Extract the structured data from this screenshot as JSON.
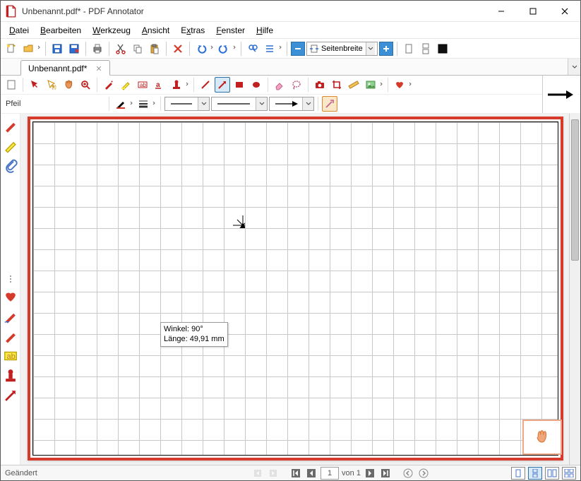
{
  "titlebar": {
    "title": "Unbenannt.pdf* - PDF Annotator"
  },
  "menu": {
    "datei": "Datei",
    "bearbeiten": "Bearbeiten",
    "werkzeug": "Werkzeug",
    "ansicht": "Ansicht",
    "extras": "Extras",
    "fenster": "Fenster",
    "hilfe": "Hilfe"
  },
  "toolbar": {
    "zoom_mode": "Seitenbreite"
  },
  "tab": {
    "label": "Unbenannt.pdf*"
  },
  "toolopts": {
    "label": "Pfeil"
  },
  "tooltip": {
    "line1": "Winkel: 90°",
    "line2": "Länge: 49,91 mm"
  },
  "status": {
    "left": "Geändert",
    "page": "1",
    "total": "von 1"
  }
}
